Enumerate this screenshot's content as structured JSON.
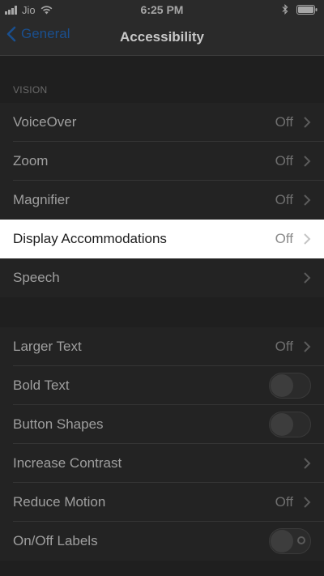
{
  "status_bar": {
    "carrier": "Jio",
    "time": "6:25 PM",
    "icons": [
      "signal-icon",
      "wifi-icon",
      "bluetooth-icon",
      "battery-icon"
    ]
  },
  "nav": {
    "back_label": "General",
    "title": "Accessibility",
    "accent_color": "#1a4f8e"
  },
  "vision": {
    "header": "VISION",
    "rows": [
      {
        "label": "VoiceOver",
        "value": "Off",
        "kind": "disclosure"
      },
      {
        "label": "Zoom",
        "value": "Off",
        "kind": "disclosure"
      },
      {
        "label": "Magnifier",
        "value": "Off",
        "kind": "disclosure"
      },
      {
        "label": "Display Accommodations",
        "value": "Off",
        "kind": "disclosure",
        "highlighted": true
      },
      {
        "label": "Speech",
        "value": "",
        "kind": "disclosure"
      }
    ]
  },
  "interaction": {
    "rows": [
      {
        "label": "Larger Text",
        "value": "Off",
        "kind": "disclosure"
      },
      {
        "label": "Bold Text",
        "kind": "toggle",
        "on": false
      },
      {
        "label": "Button Shapes",
        "kind": "toggle",
        "on": false
      },
      {
        "label": "Increase Contrast",
        "value": "",
        "kind": "disclosure"
      },
      {
        "label": "Reduce Motion",
        "value": "Off",
        "kind": "disclosure"
      },
      {
        "label": "On/Off Labels",
        "kind": "toggle",
        "on": false
      }
    ]
  }
}
